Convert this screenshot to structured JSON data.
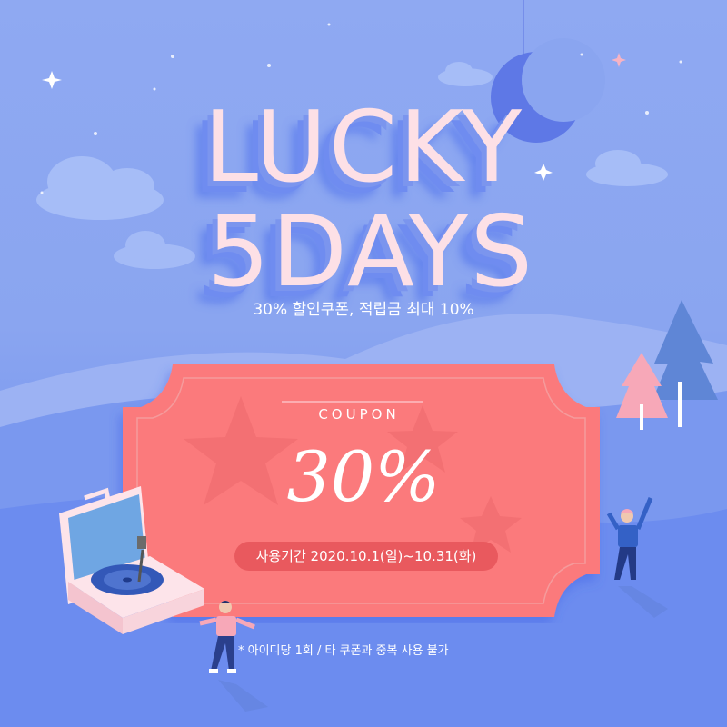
{
  "headline": {
    "line1": "LUCKY",
    "line2": "5DAYS"
  },
  "subtitle": "30% 할인쿠폰, 적립금 최대 10%",
  "coupon": {
    "label": "COUPON",
    "value": "30%",
    "period": "사용기간  2020.10.1(일)~10.31(화)"
  },
  "note": "* 아이디당 1회 / 타 쿠폰과 중복 사용 불가",
  "colors": {
    "background": "#8aa5f0",
    "coupon": "#fb7a7b",
    "period_pill": "#e9595e",
    "title": "#fde0e6",
    "moon": "#5e78e6"
  },
  "icons": [
    "moon-icon",
    "star-icon",
    "cloud-icon",
    "tree-icon",
    "record-player-icon",
    "person-icon"
  ]
}
